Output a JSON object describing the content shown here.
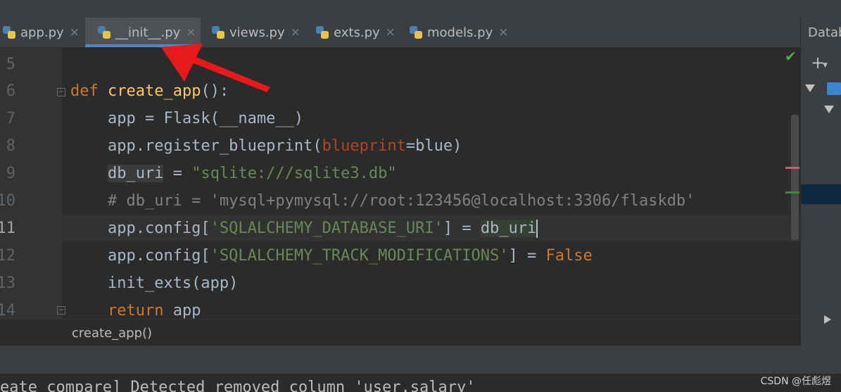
{
  "tabs": [
    {
      "label": "app.py",
      "active": false
    },
    {
      "label": "__init__.py",
      "active": true
    },
    {
      "label": "views.py",
      "active": false
    },
    {
      "label": "exts.py",
      "active": false
    },
    {
      "label": "models.py",
      "active": false
    }
  ],
  "close_glyph": "×",
  "editor": {
    "line_numbers": [
      "5",
      "6",
      "7",
      "8",
      "9",
      "10",
      "11",
      "12",
      "13",
      "14"
    ],
    "tokens": {
      "l6_kw": "def",
      "l6_fn": "create_app",
      "l6_rest": "():",
      "l7": "    app = Flask(__name__)",
      "l8_a": "    app.register_blueprint(",
      "l8_param": "blueprint",
      "l8_b": "=blue)",
      "l9_var": "db_uri",
      "l9_a": " = ",
      "l9_str": "\"sqlite:///sqlite3.db\"",
      "l10_cmt": "    # db_uri = 'mysql+pymysql://root:123456@localhost:3306/flaskdb'",
      "l11_a": "    app.config[",
      "l11_str": "'SQLALCHEMY_DATABASE_URI'",
      "l11_b": "] = ",
      "l11_var": "db_uri",
      "l12_a": "    app.config[",
      "l12_str": "'SQLALCHEMY_TRACK_MODIFICATIONS'",
      "l12_b": "] = ",
      "l12_bool": "False",
      "l13": "    init_exts(app)",
      "l14_kw": "return",
      "l14_rest": " app"
    }
  },
  "breadcrumb": "create_app()",
  "console_line": "eate compare] Detected removed column 'user.salary'",
  "right_panel": {
    "title": "Datab"
  },
  "watermark": "CSDN @任彪煜",
  "colors": {
    "accent": "#4a88c7",
    "keyword": "#cc7832",
    "string": "#6a8759",
    "function": "#ffc66d",
    "annotation_arrow": "#e8191c"
  }
}
